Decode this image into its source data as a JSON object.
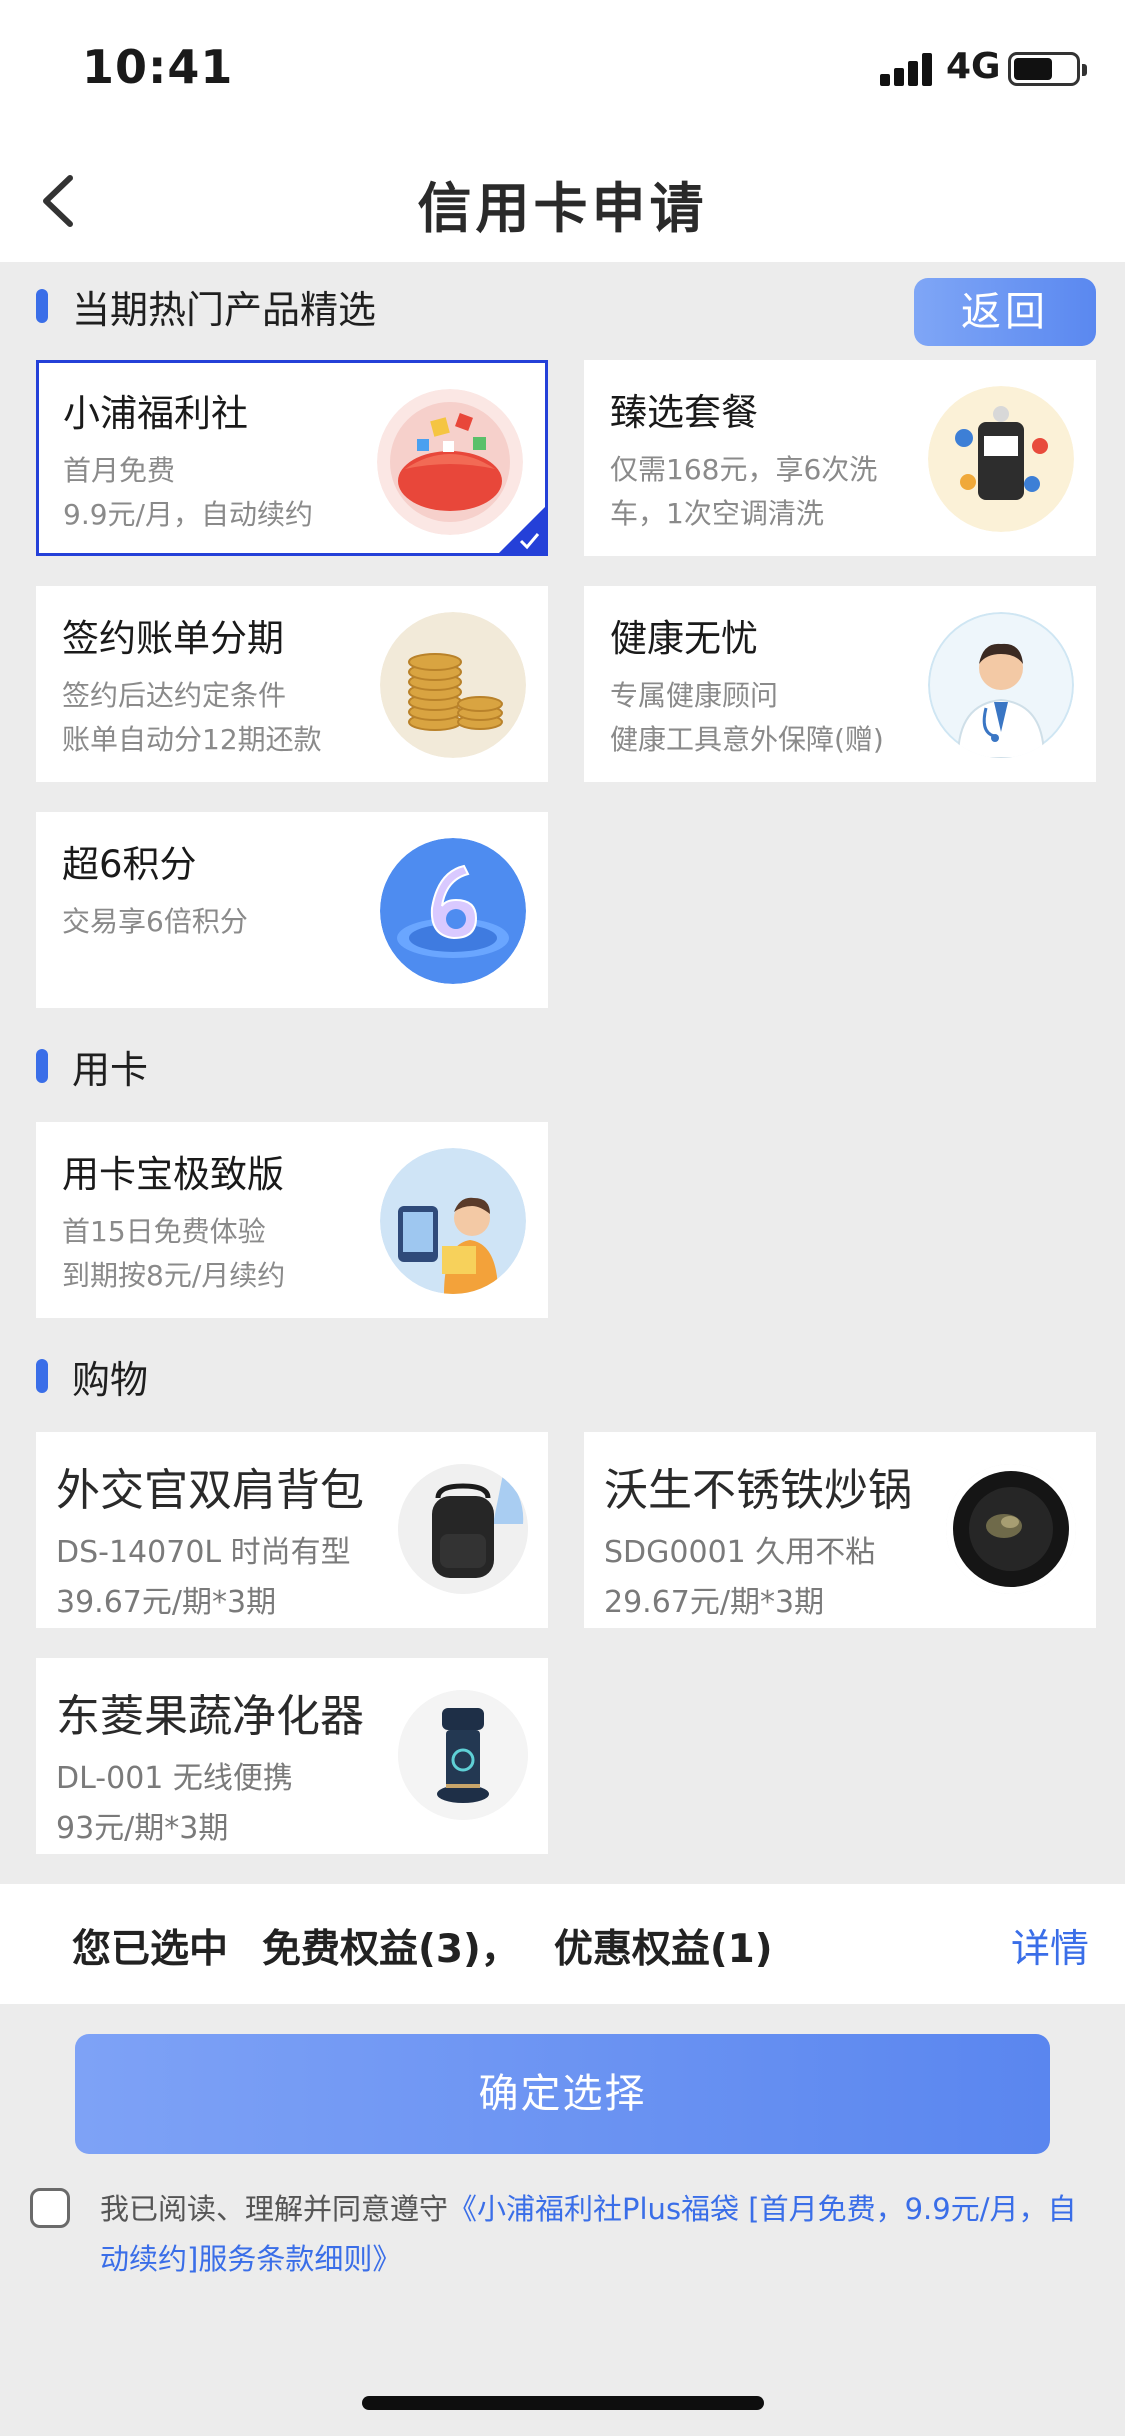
{
  "status": {
    "time": "10:41",
    "network": "4G"
  },
  "nav": {
    "title": "信用卡申请"
  },
  "sections": {
    "hot": "当期热门产品精选",
    "card_use": "用卡",
    "shopping": "购物"
  },
  "return_label": "返回",
  "hot_cards": [
    {
      "title": "小浦福利社",
      "desc1": "首月免费",
      "desc2": "9.9元/月，自动续约",
      "selected": true
    },
    {
      "title": "臻选套餐",
      "desc1": "仅需168元，享6次洗",
      "desc2": "车，1次空调清洗",
      "selected": false
    },
    {
      "title": "签约账单分期",
      "desc1": "签约后达约定条件",
      "desc2": "账单自动分12期还款",
      "selected": false
    },
    {
      "title": "健康无忧",
      "desc1": "专属健康顾问",
      "desc2": "健康工具意外保障(赠)",
      "selected": false
    },
    {
      "title": "超6积分",
      "desc1": "交易享6倍积分",
      "desc2": "",
      "selected": false
    }
  ],
  "card_use": [
    {
      "title": "用卡宝极致版",
      "desc1": "首15日免费体验",
      "desc2": "到期按8元/月续约"
    }
  ],
  "shopping": [
    {
      "title": "外交官双肩背包",
      "desc1": "DS-14070L 时尚有型",
      "desc2": "39.67元/期*3期"
    },
    {
      "title": "沃生不锈铁炒锅",
      "desc1": "SDG0001 久用不粘",
      "desc2": "29.67元/期*3期"
    },
    {
      "title": "东菱果蔬净化器",
      "desc1": "DL-001 无线便携",
      "desc2": "93元/期*3期"
    }
  ],
  "summary": {
    "prefix": "您已选中",
    "free": "免费权益(3)，",
    "discount": "优惠权益(1)",
    "detail": "详情"
  },
  "confirm_label": "确定选择",
  "agreement": {
    "text": "我已阅读、理解并同意遵守",
    "link": "《小浦福利社Plus福袋 [首月免费，9.9元/月，自动续约]服务条款细则》"
  },
  "colors": {
    "accent": "#3a6ee8",
    "selected_border": "#2440d8"
  }
}
